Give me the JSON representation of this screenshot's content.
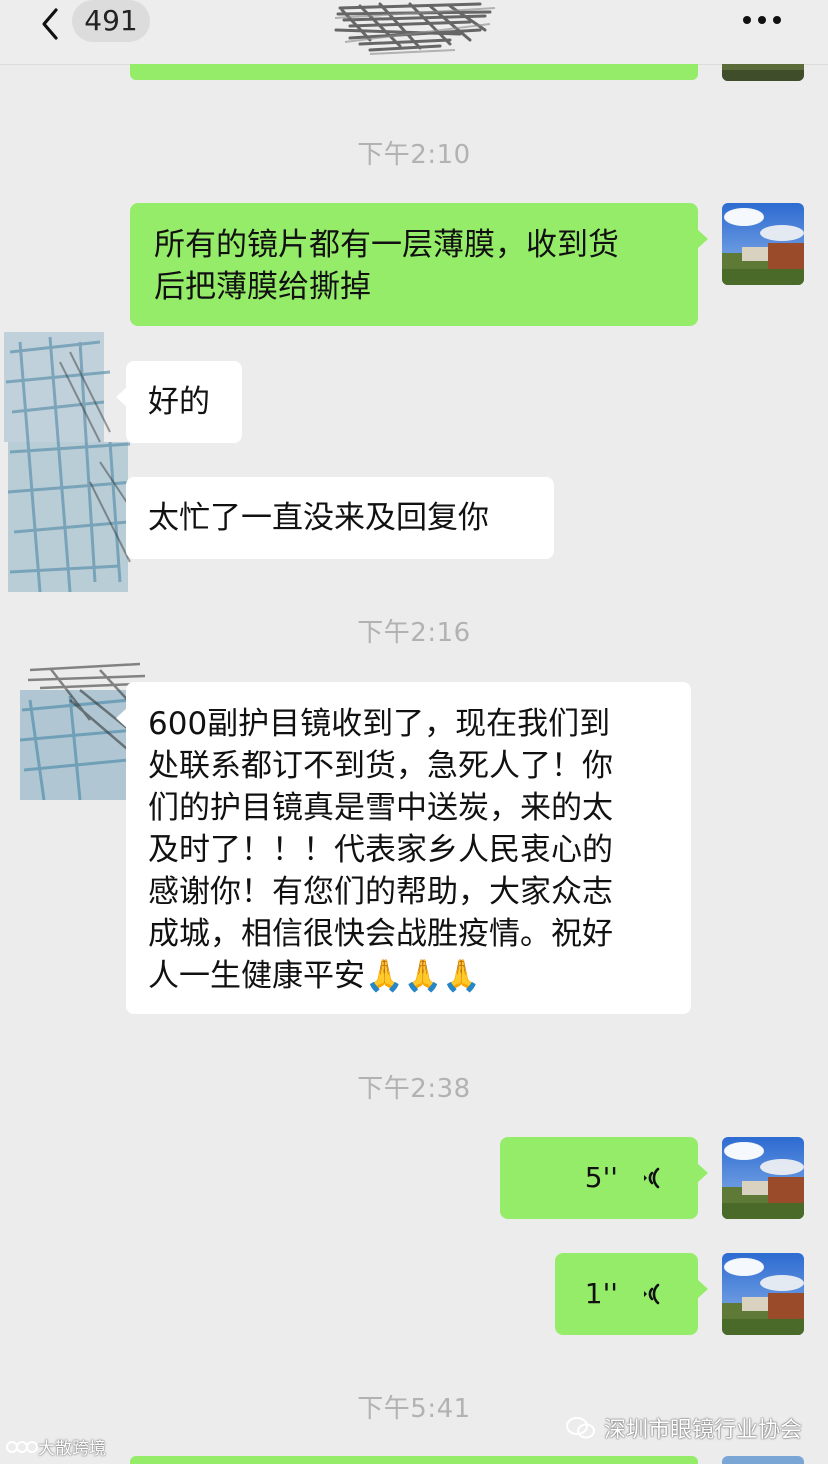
{
  "header": {
    "unread_count": "491",
    "back_icon": "chevron-left-icon",
    "more_icon": "more-dots-icon"
  },
  "messages": [
    {
      "type": "time",
      "text": "下午2:10"
    },
    {
      "type": "sent",
      "text_lines": [
        "所有的镜片都有一层薄膜，收到货",
        "后把薄膜给撕掉"
      ]
    },
    {
      "type": "received",
      "text": "好的"
    },
    {
      "type": "received",
      "text": "太忙了一直没来及回复你"
    },
    {
      "type": "time",
      "text": "下午2:16"
    },
    {
      "type": "received",
      "text_lines": [
        "600副护目镜收到了，现在我们到",
        "处联系都订不到货，急死人了！你",
        "们的护目镜真是雪中送炭，来的太",
        "及时了！！！代表家乡人民衷心的",
        "感谢你！有您们的帮助，大家众志",
        "成城，相信很快会战胜疫情。祝好",
        "人一生健康平安"
      ],
      "emoji": "🙏🙏🙏"
    },
    {
      "type": "time",
      "text": "下午2:38"
    },
    {
      "type": "sent-voice",
      "duration": "5''"
    },
    {
      "type": "sent-voice",
      "duration": "1''"
    },
    {
      "type": "time",
      "text": "下午5:41"
    }
  ],
  "watermarks": {
    "left": "大散跨境",
    "right": "深圳市眼镜行业协会"
  },
  "colors": {
    "sent_bubble": "#95ec69",
    "received_bubble": "#ffffff",
    "background": "#ececec",
    "timestamp": "#b2b2b2"
  }
}
